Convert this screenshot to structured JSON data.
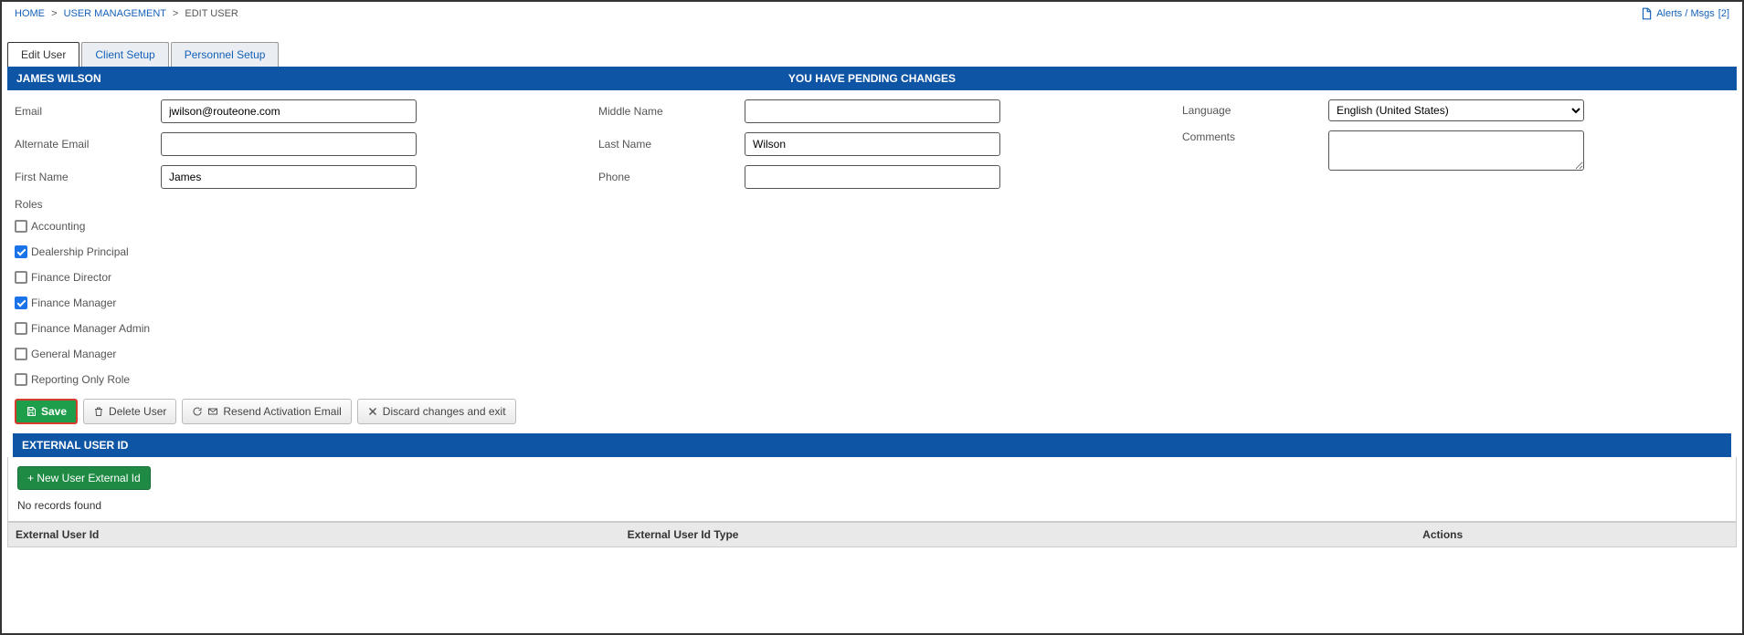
{
  "breadcrumb": {
    "home": "HOME",
    "user_mgmt": "USER MANAGEMENT",
    "current": "EDIT USER"
  },
  "alerts": {
    "label": "Alerts / Msgs",
    "count": "[2]"
  },
  "tabs": {
    "edit_user": "Edit User",
    "client_setup": "Client Setup",
    "personnel_setup": "Personnel Setup"
  },
  "header": {
    "user_name": "JAMES WILSON",
    "pending": "YOU HAVE PENDING CHANGES"
  },
  "labels": {
    "email": "Email",
    "alt_email": "Alternate Email",
    "first_name": "First Name",
    "middle_name": "Middle Name",
    "last_name": "Last Name",
    "phone": "Phone",
    "language": "Language",
    "comments": "Comments",
    "roles": "Roles"
  },
  "fields": {
    "email": "jwilson@routeone.com",
    "alt_email": "",
    "first_name": "James",
    "middle_name": "",
    "last_name": "Wilson",
    "phone": "",
    "language_selected": "English (United States)",
    "comments": ""
  },
  "roles": [
    {
      "label": "Accounting",
      "checked": false
    },
    {
      "label": "Dealership Principal",
      "checked": true
    },
    {
      "label": "Finance Director",
      "checked": false
    },
    {
      "label": "Finance Manager",
      "checked": true
    },
    {
      "label": "Finance Manager Admin",
      "checked": false
    },
    {
      "label": "General Manager",
      "checked": false
    },
    {
      "label": "Reporting Only Role",
      "checked": false
    }
  ],
  "buttons": {
    "save": "Save",
    "delete": "Delete User",
    "resend": "Resend Activation Email",
    "discard": "Discard changes and exit",
    "new_ext": "+ New User External Id"
  },
  "ext": {
    "title": "EXTERNAL USER ID",
    "no_records": "No records found",
    "col1": "External User Id",
    "col2": "External User Id Type",
    "col3": "Actions"
  }
}
